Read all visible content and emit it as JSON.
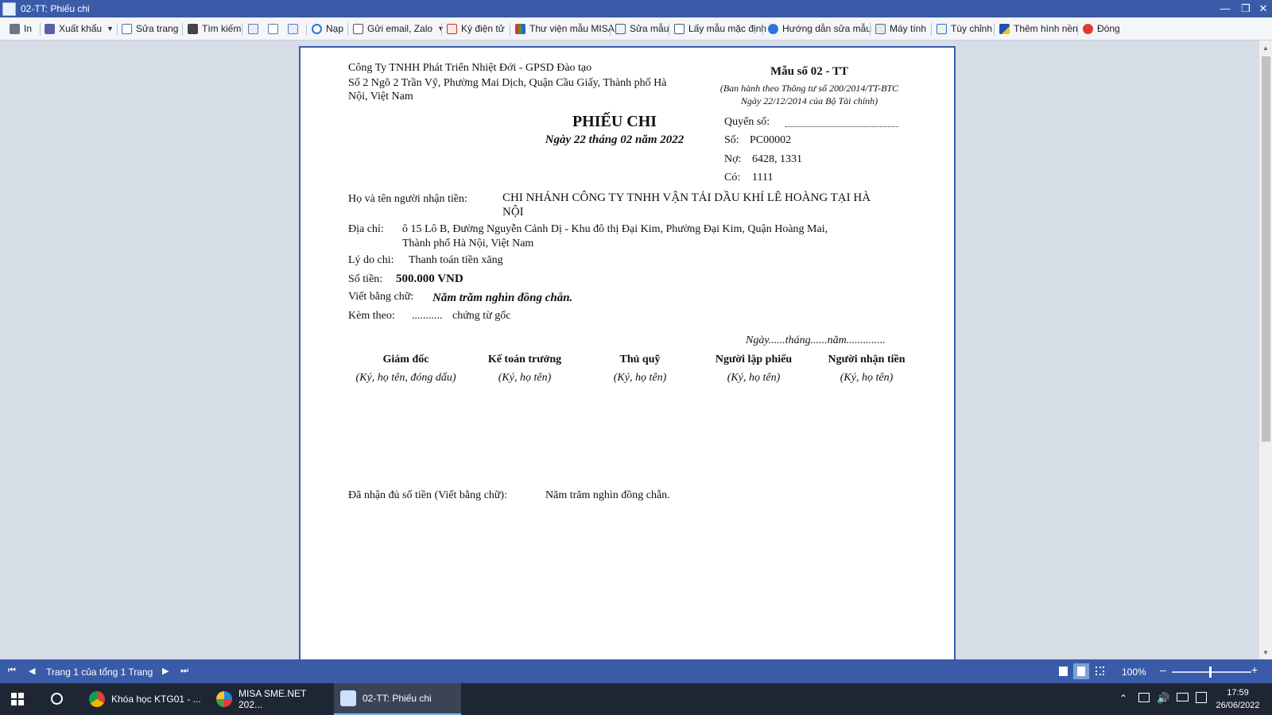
{
  "window": {
    "title": "02-TT: Phiếu chi"
  },
  "toolbar": {
    "print": "In",
    "export": "Xuất khẩu",
    "edit_page": "Sửa trang",
    "search": "Tìm kiếm",
    "reload": "Nạp",
    "send_email": "Gửi email, Zalo",
    "e_sign": "Ký điện tử",
    "library": "Thư viện mẫu MISA",
    "edit_template": "Sửa mẫu",
    "default_template": "Lấy mẫu mặc định",
    "guide": "Hướng dẫn sửa mẫu",
    "calculator": "Máy tính",
    "customize": "Tùy chỉnh",
    "background": "Thêm hình nền",
    "close": "Đóng"
  },
  "document": {
    "company_name": "Công Ty TNHH Phát Triển Nhiệt Đới - GPSD Đào tạo",
    "company_address_1": "Số 2 Ngõ 2 Trần Vỹ, Phường Mai Dịch, Quận Cầu Giấy, Thành phố Hà",
    "company_address_2": "Nội, Việt Nam",
    "form_no": "Mẫu số 02 - TT",
    "form_note_1": "(Ban hành theo Thông tư số 200/2014/TT-BTC",
    "form_note_2": "Ngày 22/12/2014 của Bộ Tài chính)",
    "title": "PHIẾU CHI",
    "date": "Ngày 22 tháng 02 năm 2022",
    "book_label": "Quyển số:",
    "number_label": "Số:",
    "number": "PC00002",
    "debit_label": "Nợ:",
    "debit": "6428, 1331",
    "credit_label": "Có:",
    "credit": "1111",
    "receiver_label": "Họ và tên người nhận tiền:",
    "receiver_1": "CHI NHÁNH CÔNG TY TNHH VẬN TẢI DẦU KHÍ LÊ HOÀNG TẠI HÀ",
    "receiver_2": "NỘI",
    "address_label": "Địa chỉ:",
    "address_1": "ô 15 Lô B, Đường Nguyễn Cảnh Dị - Khu đô thị Đại Kim, Phường Đại Kim, Quận Hoàng Mai,",
    "address_2": "Thành phố Hà Nội, Việt Nam",
    "reason_label": "Lý do chi:",
    "reason": "Thanh toán tiền xăng",
    "amount_label": "Số tiền:",
    "amount": "500.000 VND",
    "in_words_label": "Viết bằng chữ:",
    "in_words": "Năm trăm nghìn đồng chẵn.",
    "attached_label": "Kèm theo:",
    "attached_dots": "...........",
    "attached_suffix": "chứng từ gốc",
    "sign_date": "Ngày......tháng......năm..............",
    "signers": [
      {
        "title": "Giám đốc",
        "note": "(Ký, họ tên, đóng dấu)"
      },
      {
        "title": "Kế toán trưởng",
        "note": "(Ký, họ tên)"
      },
      {
        "title": "Thủ quỹ",
        "note": "(Ký, họ tên)"
      },
      {
        "title": "Người lập phiếu",
        "note": "(Ký, họ tên)"
      },
      {
        "title": "Người nhận tiền",
        "note": "(Ký, họ tên)"
      }
    ],
    "received_label": "Đã nhận đủ số tiền (Viết bằng chữ):",
    "received_value": "Năm trăm nghìn đồng chẵn."
  },
  "statusbar": {
    "page_info": "Trang 1 của tổng 1 Trang",
    "zoom": "100%"
  },
  "taskbar": {
    "items": [
      "Khóa học KTG01 - ...",
      "MISA SME.NET 202...",
      "02-TT: Phiếu chi"
    ],
    "time": "17:59",
    "date": "26/06/2022"
  },
  "colors": {
    "accent": "#3a5ba8",
    "taskbar": "#1f2633"
  }
}
